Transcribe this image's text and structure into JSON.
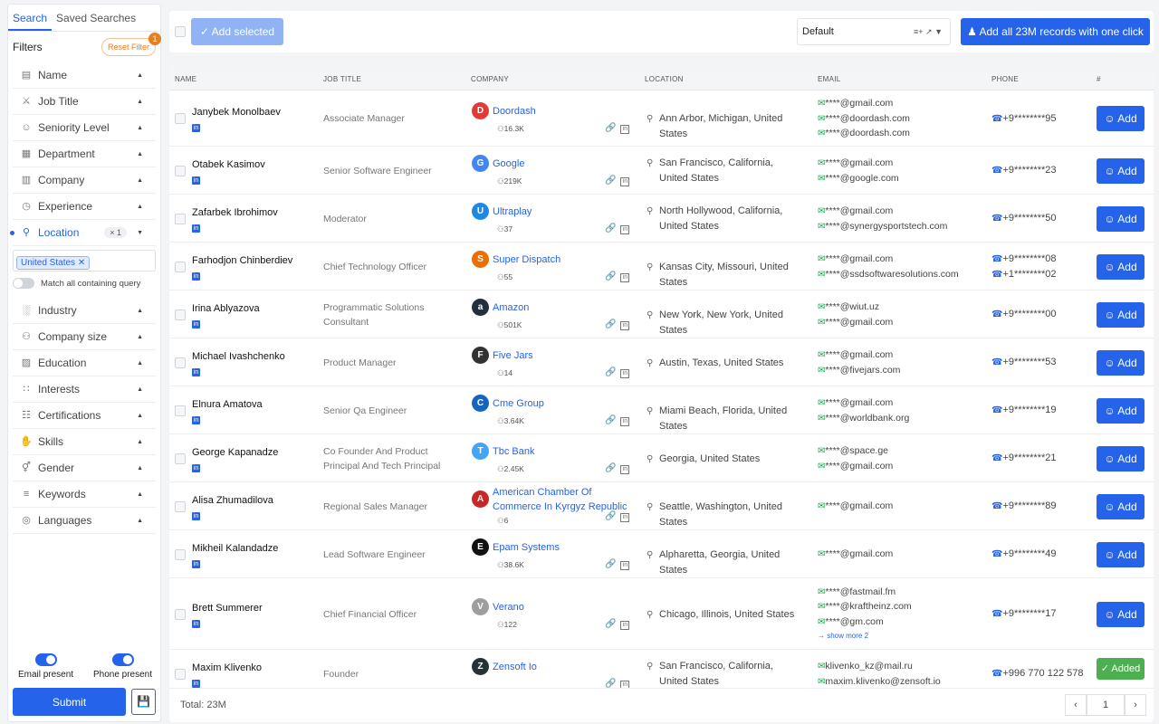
{
  "sidebar": {
    "tabs": [
      "Search",
      "Saved Searches"
    ],
    "filters_label": "Filters",
    "reset_label": "Reset Filter",
    "reset_count": "1",
    "filters_top": [
      {
        "label": "Name",
        "icon": "id-card-icon"
      },
      {
        "label": "Job Title",
        "icon": "tie-icon"
      },
      {
        "label": "Seniority Level",
        "icon": "person-rank-icon"
      },
      {
        "label": "Department",
        "icon": "building-icon"
      },
      {
        "label": "Company",
        "icon": "company-icon"
      },
      {
        "label": "Experience",
        "icon": "clock-icon"
      }
    ],
    "location": {
      "label": "Location",
      "count": "1",
      "chip": "United States",
      "match_label": "Match all containing query"
    },
    "filters_bottom": [
      {
        "label": "Industry",
        "icon": "industry-icon"
      },
      {
        "label": "Company size",
        "icon": "people-icon"
      },
      {
        "label": "Education",
        "icon": "book-icon"
      },
      {
        "label": "Interests",
        "icon": "grid-icon"
      },
      {
        "label": "Certifications",
        "icon": "certificate-icon"
      },
      {
        "label": "Skills",
        "icon": "hand-icon"
      },
      {
        "label": "Gender",
        "icon": "gender-icon"
      },
      {
        "label": "Keywords",
        "icon": "keywords-icon"
      },
      {
        "label": "Languages",
        "icon": "globe-icon"
      }
    ],
    "email_present_label": "Email present",
    "phone_present_label": "Phone present",
    "submit_label": "Submit"
  },
  "toolbar": {
    "add_selected_label": "Add selected",
    "view_select_value": "Default",
    "add_all_label": "Add all 23M records with one click"
  },
  "table": {
    "headers": [
      "NAME",
      "JOB TITLE",
      "COMPANY",
      "LOCATION",
      "EMAIL",
      "PHONE",
      "#"
    ],
    "rows": [
      {
        "name": "Janybek Monolbaev",
        "title": "Associate Manager",
        "company": "Doordash",
        "size": "16.3K",
        "logo_color": "#e53935",
        "logo_char": "D",
        "location": "Ann Arbor, Michigan, United States",
        "emails": [
          "****@gmail.com",
          "****@doordash.com",
          "****@doordash.com"
        ],
        "phones": [
          "+9********95"
        ],
        "action": "Add"
      },
      {
        "name": "Otabek Kasimov",
        "title": "Senior Software Engineer",
        "company": "Google",
        "size": "219K",
        "logo_color": "#4285f4",
        "logo_char": "G",
        "location": "San Francisco, California, United States",
        "emails": [
          "****@gmail.com",
          "****@google.com"
        ],
        "phones": [
          "+9********23"
        ],
        "action": "Add"
      },
      {
        "name": "Zafarbek Ibrohimov",
        "title": "Moderator",
        "company": "Ultraplay",
        "size": "37",
        "logo_color": "#1e88e5",
        "logo_char": "U",
        "location": "North Hollywood, California, United States",
        "emails": [
          "****@gmail.com",
          "****@synergysportstech.com"
        ],
        "phones": [
          "+9********50"
        ],
        "action": "Add"
      },
      {
        "name": "Farhodjon Chinberdiev",
        "title": "Chief Technology Officer",
        "company": "Super Dispatch",
        "size": "55",
        "logo_color": "#ef6c00",
        "logo_char": "S",
        "location": "Kansas City, Missouri, United States",
        "emails": [
          "****@gmail.com",
          "****@ssdsoftwaresolutions.com"
        ],
        "phones": [
          "+9********08",
          "+1********02"
        ],
        "action": "Add"
      },
      {
        "name": "Irina Ablyazova",
        "title": "Programmatic Solutions Consultant",
        "company": "Amazon",
        "size": "501K",
        "logo_color": "#232f3e",
        "logo_char": "a",
        "location": "New York, New York, United States",
        "emails": [
          "****@wiut.uz",
          "****@gmail.com"
        ],
        "phones": [
          "+9********00"
        ],
        "action": "Add"
      },
      {
        "name": "Michael Ivashchenko",
        "title": "Product Manager",
        "company": "Five Jars",
        "size": "14",
        "logo_color": "#333333",
        "logo_char": "F",
        "location": "Austin, Texas, United States",
        "emails": [
          "****@gmail.com",
          "****@fivejars.com"
        ],
        "phones": [
          "+9********53"
        ],
        "action": "Add"
      },
      {
        "name": "Elnura Amatova",
        "title": "Senior Qa Engineer",
        "company": "Cme Group",
        "size": "3.64K",
        "logo_color": "#1565c0",
        "logo_char": "C",
        "location": "Miami Beach, Florida, United States",
        "emails": [
          "****@gmail.com",
          "****@worldbank.org"
        ],
        "phones": [
          "+9********19"
        ],
        "action": "Add"
      },
      {
        "name": "George Kapanadze",
        "title": "Co Founder And Product Principal And Tech Principal",
        "company": "Tbc Bank",
        "size": "2.45K",
        "logo_color": "#42a5f5",
        "logo_char": "T",
        "location": "Georgia, United States",
        "emails": [
          "****@space.ge",
          "****@gmail.com"
        ],
        "phones": [
          "+9********21"
        ],
        "action": "Add"
      },
      {
        "name": "Alisa Zhumadilova",
        "title": "Regional Sales Manager",
        "company": "American Chamber Of Commerce In Kyrgyz Republic",
        "size": "6",
        "logo_color": "#c62828",
        "logo_char": "A",
        "location": "Seattle, Washington, United States",
        "emails": [
          "****@gmail.com"
        ],
        "phones": [
          "+9********89"
        ],
        "action": "Add"
      },
      {
        "name": "Mikheil Kalandadze",
        "title": "Lead Software Engineer",
        "company": "Epam Systems",
        "size": "38.6K",
        "logo_color": "#111111",
        "logo_char": "E",
        "location": "Alpharetta, Georgia, United States",
        "emails": [
          "****@gmail.com"
        ],
        "phones": [
          "+9********49"
        ],
        "action": "Add"
      },
      {
        "name": "Brett Summerer",
        "title": "Chief Financial Officer",
        "company": "Verano",
        "size": "122",
        "logo_color": "#9e9e9e",
        "logo_char": "V",
        "location": "Chicago, Illinois, United States",
        "emails": [
          "****@fastmail.fm",
          "****@kraftheinz.com",
          "****@gm.com"
        ],
        "show_more": "show more 2",
        "phones": [
          "+9********17"
        ],
        "action": "Add"
      },
      {
        "name": "Maxim Klivenko",
        "title": "Founder",
        "company": "Zensoft Io",
        "size": "",
        "logo_color": "#263238",
        "logo_char": "Z",
        "location": "San Francisco, California, United States",
        "emails": [
          "klivenko_kz@mail.ru",
          "maxim.klivenko@zensoft.io"
        ],
        "phones": [
          "+996 770 122 578"
        ],
        "action": "Added"
      }
    ],
    "total_label": "Total: 23M",
    "page": "1"
  }
}
